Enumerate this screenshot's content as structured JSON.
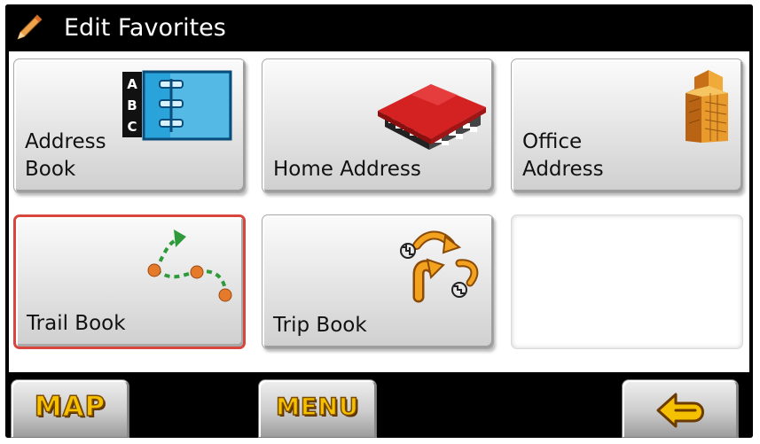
{
  "header": {
    "title": "Edit Favorites",
    "icon": "pencil-icon"
  },
  "tiles": [
    {
      "label": "Address\nBook",
      "icon": "address-book-icon",
      "selected": false
    },
    {
      "label": "Home Address",
      "icon": "home-icon",
      "selected": false
    },
    {
      "label": "Office\nAddress",
      "icon": "office-building-icon",
      "selected": false
    },
    {
      "label": "Trail Book",
      "icon": "trail-icon",
      "selected": true
    },
    {
      "label": "Trip Book",
      "icon": "trip-route-icon",
      "selected": false
    },
    {
      "label": "",
      "icon": "",
      "selected": false
    }
  ],
  "footer": {
    "map_label": "MAP",
    "menu_label": "MENU",
    "back_icon": "back-arrow-icon"
  },
  "colors": {
    "selection_border": "#d8473e",
    "button_text": "#f5c000",
    "title_text": "#ffffff"
  }
}
